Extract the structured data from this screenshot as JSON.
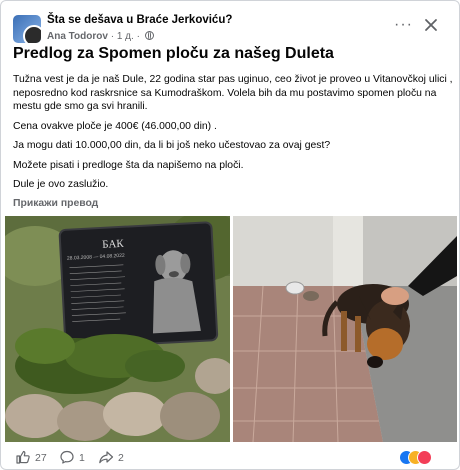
{
  "header": {
    "group_name": "Šta se dešava u Braće Jerkoviću?",
    "author": "Ana Todorov",
    "time": "1 д.",
    "more_label": "···"
  },
  "post": {
    "title": "Predlog za Spomen ploču za našeg Duleta",
    "paragraphs": [
      "Tužna vest je da je naš Dule, 22 godina star pas uginuo, ceo život je proveo u Vitanovčkoj ulici , neposredno kod raskrsnice sa Kumodraškom. Volela bih da mu postavimo spomen ploču na mestu gde smo ga svi hranili.",
      "Cena ovakve ploče je 400€ (46.000,00 din) .",
      "Ja mogu dati 10.000,00 din, da li bi još neko učestovao za ovaj gest?",
      "Možete pisati i predloge šta da napišemo na ploči.",
      "Dule je ovo zaslužio."
    ],
    "translate_label": "Прикажи превод"
  },
  "plaque": {
    "name": "БАК",
    "dates": "28.03.2008 — 04.08.2022"
  },
  "actions": {
    "likes": "27",
    "comments": "1",
    "shares": "2"
  },
  "colors": {
    "like_blue": "#1877f2",
    "love_red": "#f33e58",
    "haha_yellow": "#f7b125",
    "muted": "#65676b"
  }
}
